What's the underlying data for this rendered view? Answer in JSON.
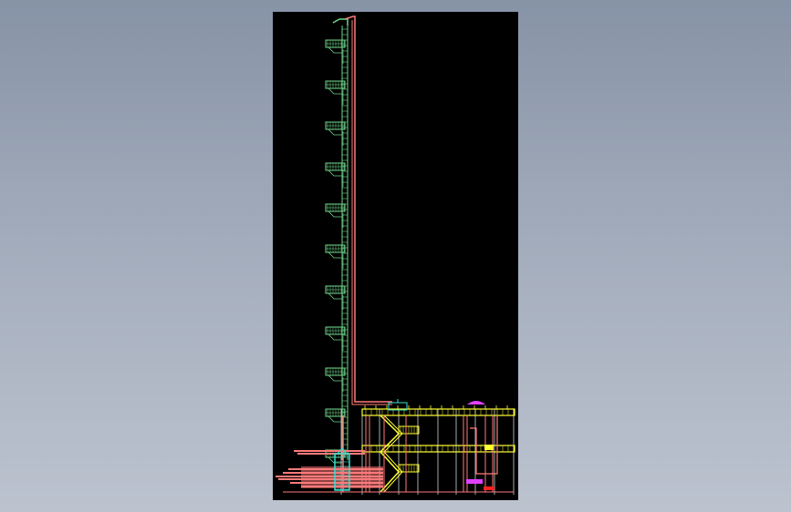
{
  "viewer": {
    "background_top": "#8793a6",
    "background_bottom": "#bcc3cf",
    "canvas_background": "#000000"
  },
  "drawing": {
    "colors": {
      "ladder": "#6fd68a",
      "pipe": "#ff7a7a",
      "structure": "#ffff33",
      "equipment": "#33e0d0",
      "accent": "#e040ff",
      "grid": "#cfd3d8",
      "red": "#ff2020"
    },
    "ladder_platform_count": 11,
    "structure_levels": 3,
    "grid_columns": 10
  }
}
